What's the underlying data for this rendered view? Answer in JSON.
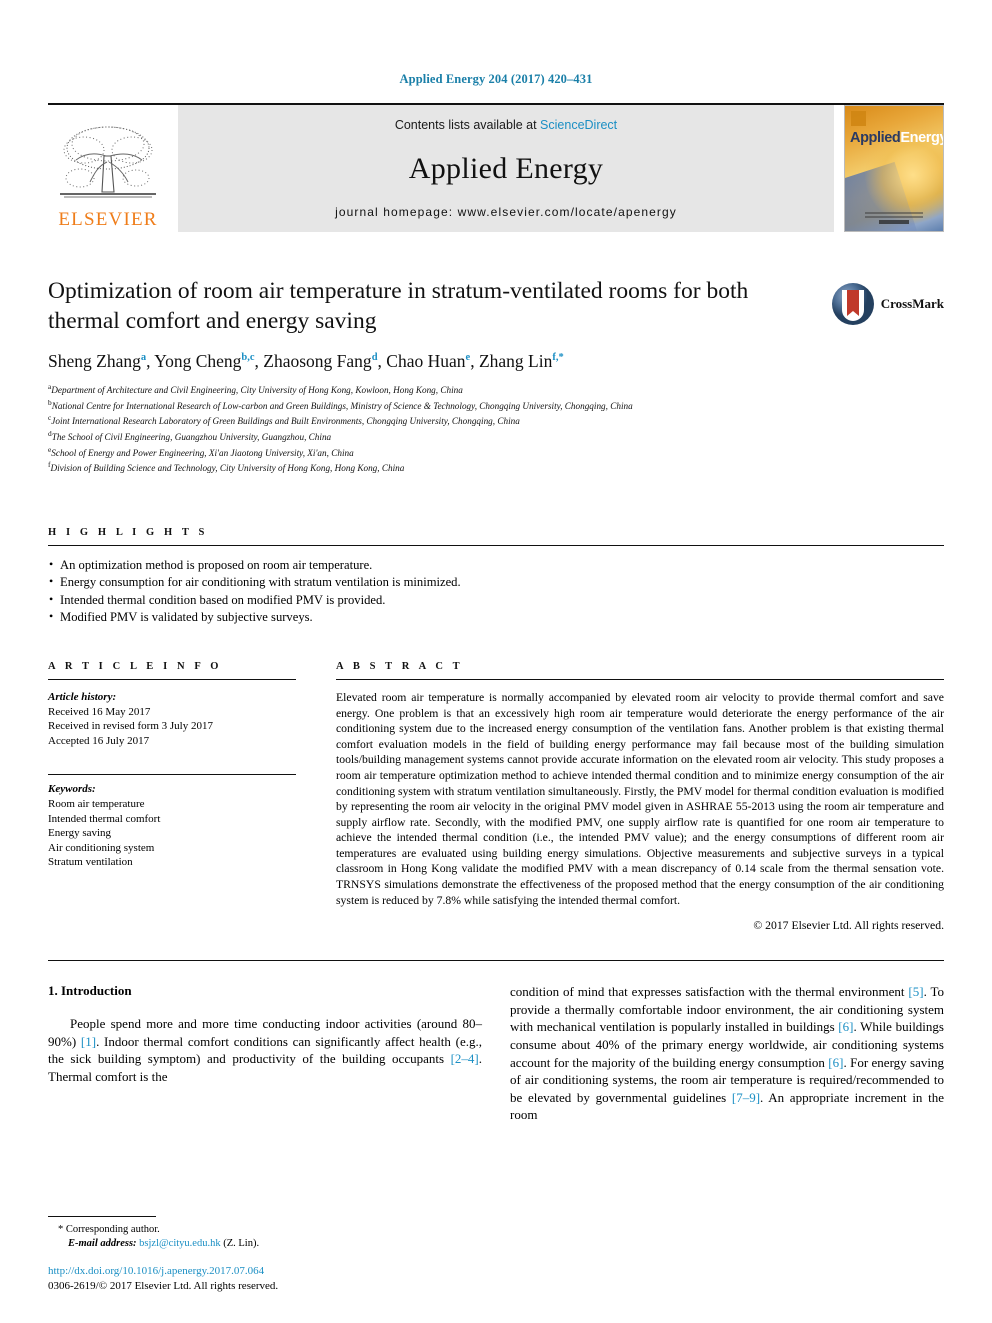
{
  "running_head": "Applied Energy 204 (2017) 420–431",
  "masthead": {
    "publisher": "ELSEVIER",
    "contents_prefix": "Contents lists available at ",
    "contents_link": "ScienceDirect",
    "journal_name": "Applied Energy",
    "homepage": "journal homepage: www.elsevier.com/locate/apenergy",
    "cover_title_a": "Applied",
    "cover_title_b": "Energy"
  },
  "article": {
    "title": "Optimization of room air temperature in stratum-ventilated rooms for both thermal comfort and energy saving",
    "crossmark_label": "CrossMark",
    "authors": [
      {
        "name": "Sheng Zhang",
        "sup": "a",
        "sep": ", "
      },
      {
        "name": "Yong Cheng",
        "sup": "b,c",
        "sep": ", "
      },
      {
        "name": "Zhaosong Fang",
        "sup": "d",
        "sep": ", "
      },
      {
        "name": "Chao Huan",
        "sup": "e",
        "sep": ", "
      },
      {
        "name": "Zhang Lin",
        "sup": "f,*",
        "sep": ""
      }
    ],
    "affiliations": [
      {
        "sup": "a",
        "text": "Department of Architecture and Civil Engineering, City University of Hong Kong, Kowloon, Hong Kong, China"
      },
      {
        "sup": "b",
        "text": "National Centre for International Research of Low-carbon and Green Buildings, Ministry of Science & Technology, Chongqing University, Chongqing, China"
      },
      {
        "sup": "c",
        "text": "Joint International Research Laboratory of Green Buildings and Built Environments, Chongqing University, Chongqing, China"
      },
      {
        "sup": "d",
        "text": "The School of Civil Engineering, Guangzhou University, Guangzhou, China"
      },
      {
        "sup": "e",
        "text": "School of Energy and Power Engineering, Xi'an Jiaotong University, Xi'an, China"
      },
      {
        "sup": "f",
        "text": "Division of Building Science and Technology, City University of Hong Kong, Hong Kong, China"
      }
    ]
  },
  "highlights": {
    "heading": "H I G H L I G H T S",
    "items": [
      "An optimization method is proposed on room air temperature.",
      "Energy consumption for air conditioning with stratum ventilation is minimized.",
      "Intended thermal condition based on modified PMV is provided.",
      "Modified PMV is validated by subjective surveys."
    ]
  },
  "article_info": {
    "heading": "A R T I C L E   I N F O",
    "history_label": "Article history:",
    "history": [
      "Received 16 May 2017",
      "Received in revised form 3 July 2017",
      "Accepted 16 July 2017"
    ],
    "keywords_label": "Keywords:",
    "keywords": [
      "Room air temperature",
      "Intended thermal comfort",
      "Energy saving",
      "Air conditioning system",
      "Stratum ventilation"
    ]
  },
  "abstract": {
    "heading": "A B S T R A C T",
    "text": "Elevated room air temperature is normally accompanied by elevated room air velocity to provide thermal comfort and save energy. One problem is that an excessively high room air temperature would deteriorate the energy performance of the air conditioning system due to the increased energy consumption of the ventilation fans. Another problem is that existing thermal comfort evaluation models in the field of building energy performance may fail because most of the building simulation tools/building management systems cannot provide accurate information on the elevated room air velocity. This study proposes a room air temperature optimization method to achieve intended thermal condition and to minimize energy consumption of the air conditioning system with stratum ventilation simultaneously. Firstly, the PMV model for thermal condition evaluation is modified by representing the room air velocity in the original PMV model given in ASHRAE 55-2013 using the room air temperature and supply airflow rate. Secondly, with the modified PMV, one supply airflow rate is quantified for one room air temperature to achieve the intended thermal condition (i.e., the intended PMV value); and the energy consumptions of different room air temperatures are evaluated using building energy simulations. Objective measurements and subjective surveys in a typical classroom in Hong Kong validate the modified PMV with a mean discrepancy of 0.14 scale from the thermal sensation vote. TRNSYS simulations demonstrate the effectiveness of the proposed method that the energy consumption of the air conditioning system is reduced by 7.8% while satisfying the intended thermal comfort.",
    "copyright": "© 2017 Elsevier Ltd. All rights reserved."
  },
  "introduction": {
    "heading": "1. Introduction",
    "left_paragraph_parts": [
      {
        "t": "People spend more and more time conducting indoor activities (around 80–90%) "
      },
      {
        "t": "[1]",
        "ref": true
      },
      {
        "t": ". Indoor thermal comfort conditions can significantly affect health (e.g., the sick building symptom) and productivity of the building occupants "
      },
      {
        "t": "[2–4]",
        "ref": true
      },
      {
        "t": ". Thermal comfort is the"
      }
    ],
    "right_paragraph_parts": [
      {
        "t": "condition of mind that expresses satisfaction with the thermal environment "
      },
      {
        "t": "[5]",
        "ref": true
      },
      {
        "t": ". To provide a thermally comfortable indoor environment, the air conditioning system with mechanical ventilation is popularly installed in buildings "
      },
      {
        "t": "[6]",
        "ref": true
      },
      {
        "t": ". While buildings consume about 40% of the primary energy worldwide, air conditioning systems account for the majority of the building energy consumption "
      },
      {
        "t": "[6]",
        "ref": true
      },
      {
        "t": ". For energy saving of air conditioning systems, the room air temperature is required/recommended to be elevated by governmental guidelines "
      },
      {
        "t": "[7–9]",
        "ref": true
      },
      {
        "t": ". An appropriate increment in the room"
      }
    ]
  },
  "footnote": {
    "corresponding": "* Corresponding author.",
    "email_label": "E-mail address:",
    "email": "bsjzl@cityu.edu.hk",
    "email_owner": "(Z. Lin)."
  },
  "footer": {
    "doi": "http://dx.doi.org/10.1016/j.apenergy.2017.07.064",
    "issn_line": "0306-2619/© 2017 Elsevier Ltd. All rights reserved."
  },
  "colors": {
    "link": "#1b8fc4",
    "running_head": "#1a7fa8",
    "elsevier_orange": "#ef7d1a"
  }
}
